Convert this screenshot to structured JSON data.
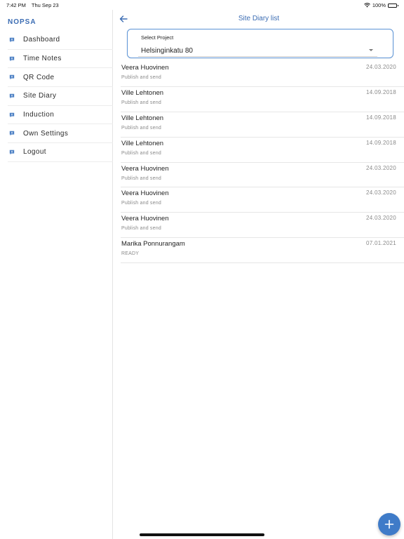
{
  "status_bar": {
    "time": "7:42 PM",
    "date": "Thu Sep 23",
    "battery": "100%"
  },
  "sidebar": {
    "brand": "NOPSA",
    "items": [
      {
        "label": "Dashboard",
        "icon": "chat-bubble-icon"
      },
      {
        "label": "Time Notes",
        "icon": "chat-bubble-icon"
      },
      {
        "label": "QR Code",
        "icon": "chat-bubble-icon"
      },
      {
        "label": "Site Diary",
        "icon": "chat-bubble-icon"
      },
      {
        "label": "Induction",
        "icon": "chat-bubble-icon"
      },
      {
        "label": "Own Settings",
        "icon": "chat-bubble-icon"
      },
      {
        "label": "Logout",
        "icon": "chat-bubble-icon"
      }
    ]
  },
  "header": {
    "title": "Site Diary list"
  },
  "project_select": {
    "label": "Select Project",
    "value": "Helsinginkatu 80"
  },
  "entries": [
    {
      "name": "Veera Huovinen",
      "status": "Publish and send",
      "date": "24.03.2020"
    },
    {
      "name": "Ville Lehtonen",
      "status": "Publish and send",
      "date": "14.09.2018"
    },
    {
      "name": "Ville Lehtonen",
      "status": "Publish and send",
      "date": "14.09.2018"
    },
    {
      "name": "Ville Lehtonen",
      "status": "Publish and send",
      "date": "14.09.2018"
    },
    {
      "name": "Veera Huovinen",
      "status": "Publish and send",
      "date": "24.03.2020"
    },
    {
      "name": "Veera Huovinen",
      "status": "Publish and send",
      "date": "24.03.2020"
    },
    {
      "name": "Veera Huovinen",
      "status": "Publish and send",
      "date": "24.03.2020"
    },
    {
      "name": "Marika Ponnurangam",
      "status": "READY",
      "date": "07.01.2021"
    }
  ],
  "colors": {
    "accent": "#3b6cb3",
    "fab": "#3f7bc8",
    "select_border": "#5b93d6"
  }
}
